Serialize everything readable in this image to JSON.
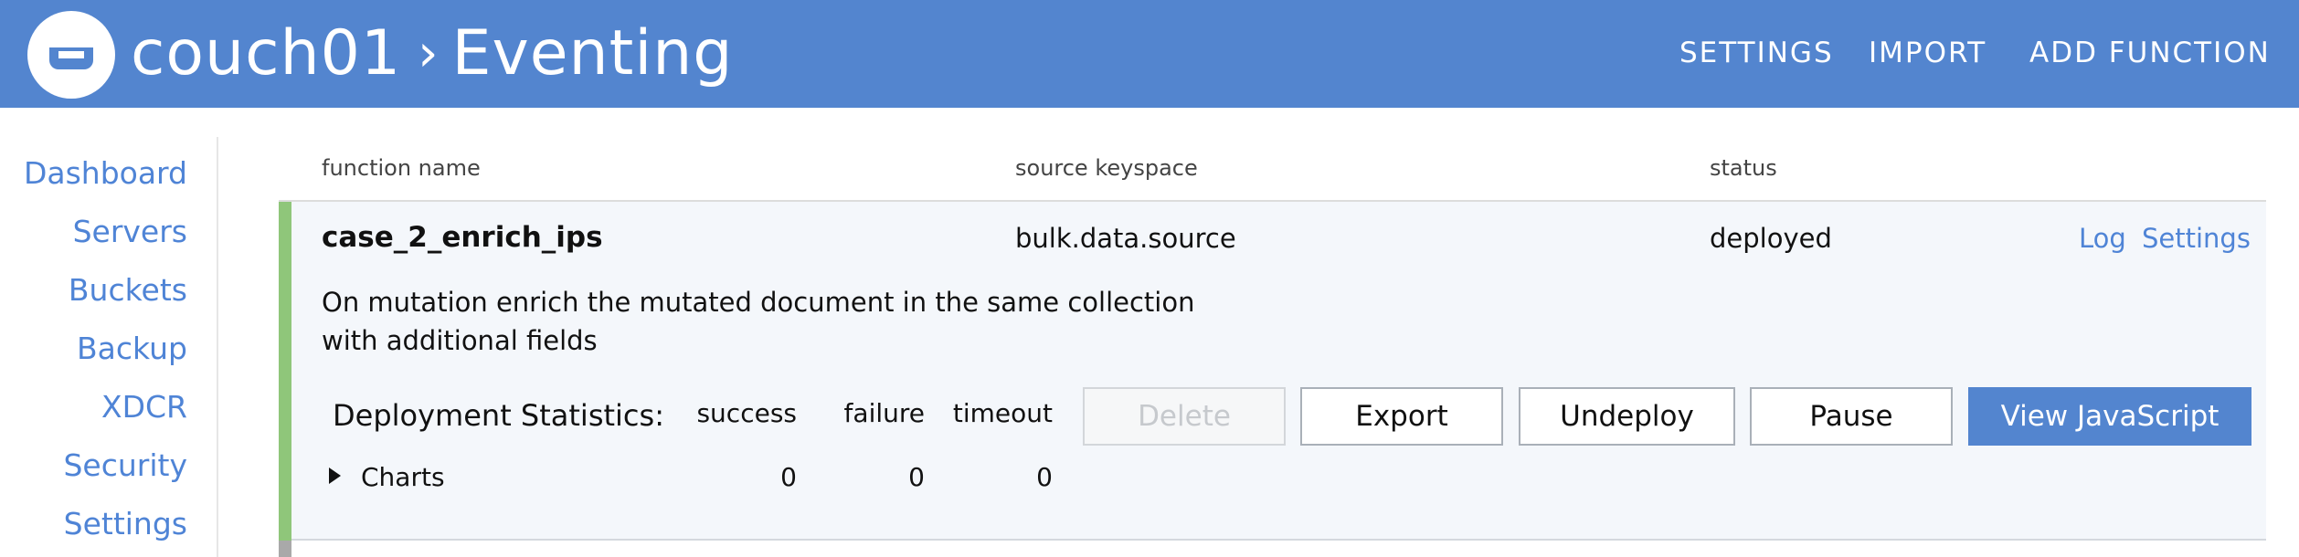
{
  "header": {
    "cluster": "couch01",
    "section": "Eventing",
    "nav": [
      "SETTINGS",
      "IMPORT",
      "ADD FUNCTION"
    ]
  },
  "sidebar": {
    "items": [
      "Dashboard",
      "Servers",
      "Buckets",
      "Backup",
      "XDCR",
      "Security",
      "Settings"
    ]
  },
  "table": {
    "columns": [
      "function name",
      "source keyspace",
      "status"
    ],
    "rows": [
      {
        "name": "case_2_enrich_ips",
        "keyspace": "bulk.data.source",
        "status": "deployed",
        "links": [
          "Log",
          "Settings"
        ],
        "description": "On mutation enrich the mutated document in the same collection with additional fields",
        "stats_label": "Deployment Statistics:",
        "stats_headers": [
          "success",
          "failure",
          "timeout"
        ],
        "stats_values": [
          "0",
          "0",
          "0"
        ],
        "charts_label": "Charts",
        "buttons": [
          "Delete",
          "Export",
          "Undeploy",
          "Pause",
          "View JavaScript"
        ]
      }
    ]
  },
  "colors": {
    "brand_blue": "#5385cf",
    "link_blue": "#4f84d6",
    "deployed_green": "#8fc67a"
  },
  "icons": {
    "logo": "couchbase-logo-icon",
    "breadcrumb_separator": "chevron-right-icon",
    "charts_toggle": "caret-right-icon"
  }
}
